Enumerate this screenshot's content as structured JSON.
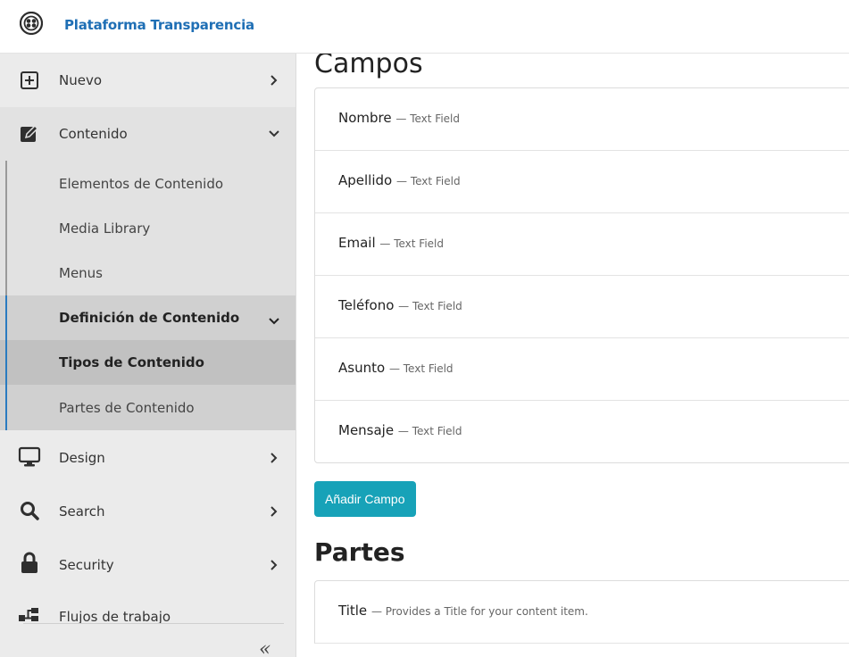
{
  "brand": {
    "name": "Plataforma Transparencia"
  },
  "sidebar": {
    "items": [
      {
        "label": "Nuevo",
        "icon": "plus-square-icon"
      },
      {
        "label": "Contenido",
        "icon": "edit-icon"
      },
      {
        "label": "Design",
        "icon": "monitor-icon"
      },
      {
        "label": "Search",
        "icon": "search-icon"
      },
      {
        "label": "Security",
        "icon": "lock-icon"
      },
      {
        "label": "Flujos de trabajo",
        "icon": "workflow-icon"
      }
    ],
    "contenido_children": [
      {
        "label": "Elementos de Contenido"
      },
      {
        "label": "Media Library"
      },
      {
        "label": "Menus"
      },
      {
        "label": "Definición de Contenido"
      },
      {
        "label": "Tipos de Contenido"
      },
      {
        "label": "Partes de Contenido"
      }
    ],
    "collapse_label": "«"
  },
  "main": {
    "campos_title": "Campos",
    "fields": [
      {
        "name": "Nombre",
        "type": "— Text Field"
      },
      {
        "name": "Apellido",
        "type": "— Text Field"
      },
      {
        "name": "Email",
        "type": "— Text Field"
      },
      {
        "name": "Teléfono",
        "type": "— Text Field"
      },
      {
        "name": "Asunto",
        "type": "— Text Field"
      },
      {
        "name": "Mensaje",
        "type": "— Text Field"
      }
    ],
    "add_field_label": "Añadir Campo",
    "partes_title": "Partes",
    "parts": [
      {
        "name": "Title",
        "desc": "— Provides a Title for your content item."
      }
    ]
  },
  "colors": {
    "brand": "#1f6fb5",
    "button": "#17a2b8",
    "active_bar": "#2a7bc0"
  }
}
